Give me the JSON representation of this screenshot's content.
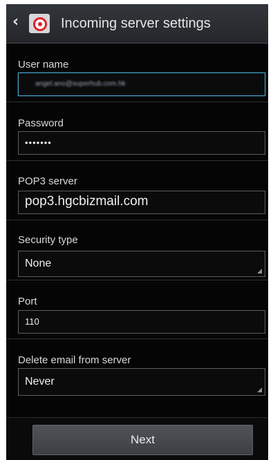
{
  "header": {
    "back_icon": "back-chevron-icon",
    "app_icon": "email-app-icon",
    "title": "Incoming server settings"
  },
  "form": {
    "username": {
      "label": "User name",
      "value": "angel.ano@superhub.com.hk"
    },
    "password": {
      "label": "Password",
      "value": "•••••••"
    },
    "server": {
      "label": "POP3 server",
      "value": "pop3.hgcbizmail.com"
    },
    "security": {
      "label": "Security type",
      "value": "None"
    },
    "port": {
      "label": "Port",
      "value": "110"
    },
    "delete": {
      "label": "Delete email from server",
      "value": "Never"
    }
  },
  "actions": {
    "next_label": "Next"
  },
  "colors": {
    "background": "#050505",
    "appbar": "#2c2f33",
    "focus_border": "#4aa3c9",
    "text": "#e6e6e6"
  }
}
